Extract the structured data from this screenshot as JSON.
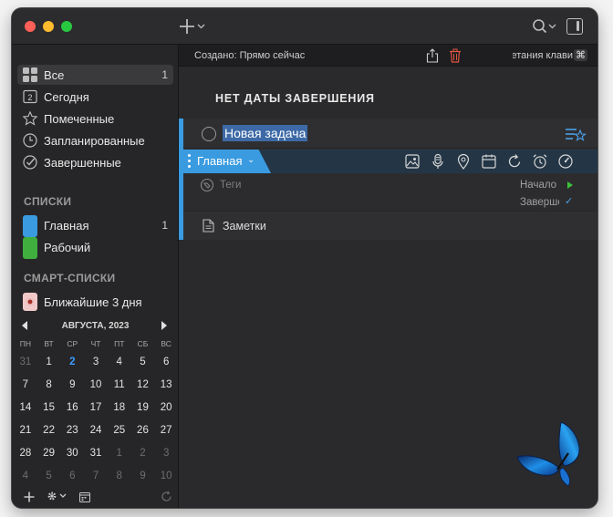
{
  "window": {
    "traffic_lights": {
      "close": "#fe5f57",
      "minimize": "#febc2e",
      "maximize": "#28c840"
    }
  },
  "toolbar": {
    "add_icon": "plus-icon",
    "search_icon": "search-icon",
    "inspector_icon": "sidebar-right-icon"
  },
  "sidebar": {
    "items": [
      {
        "label": "Все",
        "count": "1",
        "icon": "grid-icon",
        "selected": true
      },
      {
        "label": "Сегодня",
        "count": "",
        "icon": "calendar-2-icon"
      },
      {
        "label": "Помеченные",
        "count": "",
        "icon": "star-icon"
      },
      {
        "label": "Запланированные",
        "count": "",
        "icon": "clock-icon"
      },
      {
        "label": "Завершенные",
        "count": "",
        "icon": "check-circle-icon"
      }
    ],
    "lists_heading": "СПИСКИ",
    "lists": [
      {
        "label": "Главная",
        "count": "1",
        "color": "#3a9be0"
      },
      {
        "label": "Рабочий",
        "count": "",
        "color": "#3fae3f"
      }
    ],
    "smart_heading": "СМАРТ-СПИСКИ",
    "smart_lists": [
      {
        "label": "Ближайшие 3 дня",
        "icon": "smart-list-icon"
      }
    ],
    "today_icon_number": "2"
  },
  "calendar": {
    "title": "АВГУСТА, 2023",
    "weekdays": [
      "ПН",
      "ВТ",
      "СР",
      "ЧТ",
      "ПТ",
      "СБ",
      "ВС"
    ],
    "weeks": [
      [
        "31",
        "1",
        "2",
        "3",
        "4",
        "5",
        "6"
      ],
      [
        "7",
        "8",
        "9",
        "10",
        "11",
        "12",
        "13"
      ],
      [
        "14",
        "15",
        "16",
        "17",
        "18",
        "19",
        "20"
      ],
      [
        "21",
        "22",
        "23",
        "24",
        "25",
        "26",
        "27"
      ],
      [
        "28",
        "29",
        "30",
        "31",
        "1",
        "2",
        "3"
      ],
      [
        "4",
        "5",
        "6",
        "7",
        "8",
        "9",
        "10"
      ]
    ],
    "today": "2"
  },
  "main": {
    "created": "Создано: Прямо сейчас",
    "shortcuts_hint": "четания клави",
    "cmd_symbol": "⌘",
    "group_title": "НЕТ ДАТЫ ЗАВЕРШЕНИЯ",
    "task": {
      "title": "Новая задача",
      "list_name": "Главная",
      "list_color": "#3a9be0",
      "tags_placeholder": "Теги",
      "start_label": "Начало",
      "due_label": "Завершение",
      "notes_label": "Заметки"
    }
  }
}
